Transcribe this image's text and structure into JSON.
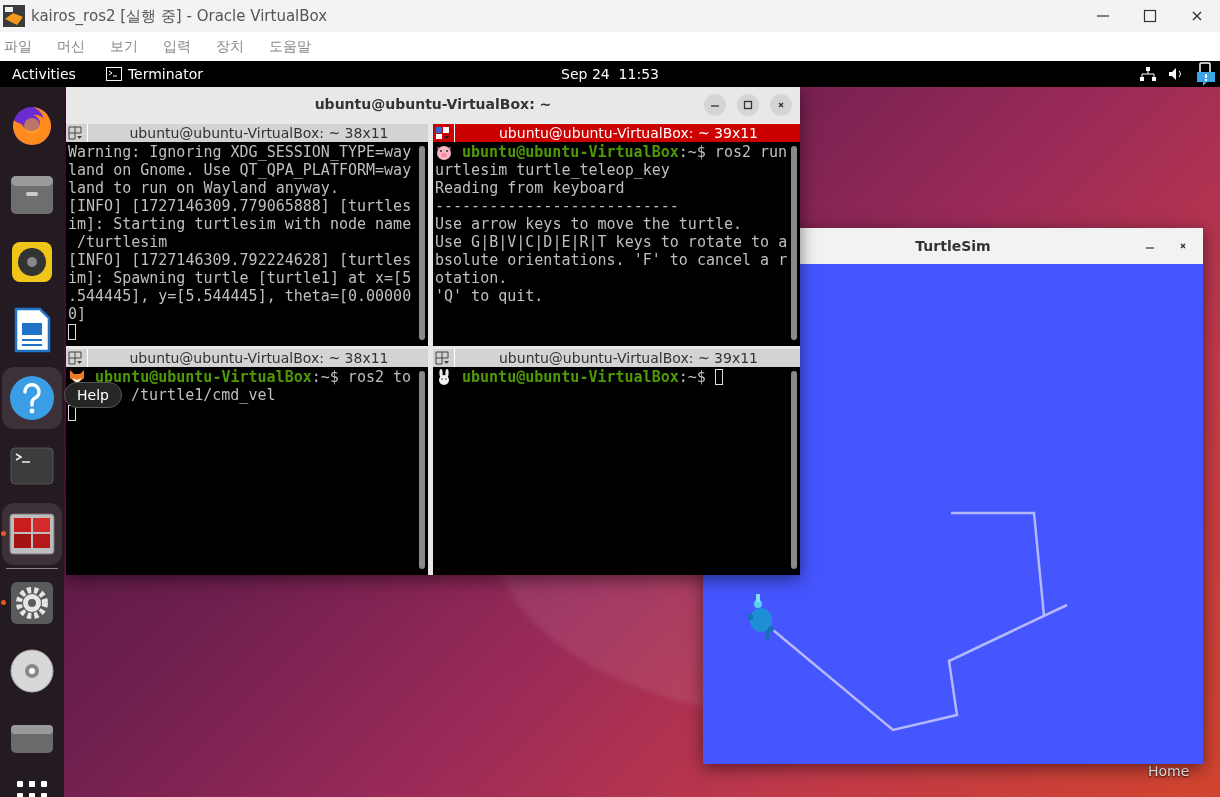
{
  "vbox": {
    "title": "kairos_ros2 [실행 중] - Oracle VirtualBox",
    "menu": [
      "파일",
      "머신",
      "보기",
      "입력",
      "장치",
      "도움말"
    ]
  },
  "topbar": {
    "activities": "Activities",
    "app": "Terminator",
    "clock": "Sep 24  11:53"
  },
  "dock": {
    "items": [
      {
        "kind": "firefox",
        "running": false,
        "highlighted": false
      },
      {
        "kind": "files",
        "running": false,
        "highlighted": false
      },
      {
        "kind": "music",
        "running": false,
        "highlighted": false
      },
      {
        "kind": "writer",
        "running": false,
        "highlighted": false
      },
      {
        "kind": "help",
        "running": false,
        "highlighted": true,
        "tooltip": "Help"
      },
      {
        "kind": "terminal",
        "running": false,
        "highlighted": false
      },
      {
        "kind": "terminator",
        "running": true,
        "highlighted": true
      },
      {
        "kind": "separator"
      },
      {
        "kind": "settings",
        "running": true,
        "highlighted": false
      },
      {
        "kind": "disc",
        "running": false,
        "highlighted": false
      },
      {
        "kind": "drive",
        "running": false,
        "highlighted": false
      }
    ]
  },
  "terminator": {
    "title": "ubuntu@ubuntu-VirtualBox: ~",
    "panes": [
      {
        "header": "ubuntu@ubuntu-VirtualBox: ~ 38x11",
        "selected": false,
        "lines": [
          {
            "kind": "text",
            "text": "Warning: Ignoring XDG_SESSION_TYPE=way"
          },
          {
            "kind": "text",
            "text": "land on Gnome. Use QT_QPA_PLATFORM=way"
          },
          {
            "kind": "text",
            "text": "land to run on Wayland anyway."
          },
          {
            "kind": "text",
            "text": "[INFO] [1727146309.779065888] [turtles"
          },
          {
            "kind": "text",
            "text": "im]: Starting turtlesim with node name"
          },
          {
            "kind": "text",
            "text": " /turtlesim"
          },
          {
            "kind": "text",
            "text": "[INFO] [1727146309.792224628] [turtles"
          },
          {
            "kind": "text",
            "text": "im]: Spawning turtle [turtle1] at x=[5"
          },
          {
            "kind": "text",
            "text": ".544445], y=[5.544445], theta=[0.00000"
          },
          {
            "kind": "text",
            "text": "0]"
          },
          {
            "kind": "cursor"
          }
        ]
      },
      {
        "header": "ubuntu@ubuntu-VirtualBox: ~ 39x11",
        "selected": true,
        "lines": [
          {
            "kind": "prompt",
            "user": "ubuntu@ubuntu-VirtualBox",
            "text": ":~$ ros2 run",
            "cursor": false
          },
          {
            "kind": "text",
            "text": "urtlesim turtle_teleop_key"
          },
          {
            "kind": "text",
            "text": "Reading from keyboard"
          },
          {
            "kind": "text",
            "text": "---------------------------"
          },
          {
            "kind": "text",
            "text": "Use arrow keys to move the turtle."
          },
          {
            "kind": "text",
            "text": "Use G|B|V|C|D|E|R|T keys to rotate to a"
          },
          {
            "kind": "text",
            "text": "bsolute orientations. 'F' to cancel a r"
          },
          {
            "kind": "text",
            "text": "otation."
          },
          {
            "kind": "text",
            "text": "'Q' to quit."
          }
        ]
      },
      {
        "header": "ubuntu@ubuntu-VirtualBox: ~ 38x11",
        "selected": false,
        "lines": [
          {
            "kind": "prompt",
            "user": "ubuntu@ubuntu-VirtualBox",
            "text": ":~$ ros2 to",
            "cursor": false
          },
          {
            "kind": "covered",
            "text": "/turtle1/cmd_vel"
          },
          {
            "kind": "cursor"
          }
        ]
      },
      {
        "header": "ubuntu@ubuntu-VirtualBox: ~ 39x11",
        "selected": false,
        "lines": [
          {
            "kind": "prompt",
            "user": "ubuntu@ubuntu-VirtualBox",
            "text": ":~$",
            "cursor": true
          }
        ]
      }
    ]
  },
  "turtlesim": {
    "title": "TurtleSim"
  },
  "desktop_icons": [
    {
      "label": "Home"
    }
  ]
}
